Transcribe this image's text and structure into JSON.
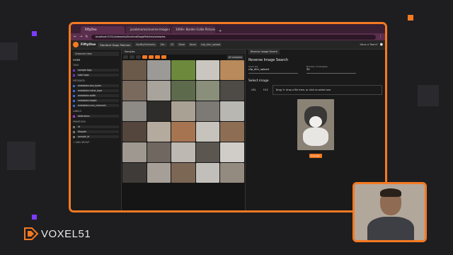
{
  "browser": {
    "tabs": [
      {
        "label": "FiftyOne"
      },
      {
        "label": "jacobmarks/reverse-image-se..."
      },
      {
        "label": "1000+ Border Collie Pictures..."
      }
    ],
    "url": "localhost:5151/datasets/StanfordDogsPatches/samples"
  },
  "app": {
    "brand": "FiftyOne",
    "dataset": "Stanford Dogs Patches",
    "view_stages": [
      "SortBySimilarity",
      "4fe..",
      "25",
      "False",
      "None",
      "clip_dim_upload"
    ],
    "header_right": "Have a Team?"
  },
  "sidebar": {
    "view_select": "Unsaved view",
    "filter_label": "FILTER",
    "sections": [
      {
        "title": "TAGS",
        "items": [
          "sample tags",
          "label tags"
        ]
      },
      {
        "title": "METADATA",
        "items": [
          "metadata.size_bytes",
          "metadata.mime_type",
          "metadata.width",
          "metadata.height",
          "metadata.num_channels"
        ]
      },
      {
        "title": "LABELS",
        "items": [
          "detections"
        ]
      },
      {
        "title": "PRIMITIVES",
        "items": [
          "id",
          "filepath",
          "sample_id"
        ]
      }
    ],
    "add_group": "+ ADD GROUP"
  },
  "grid": {
    "tab_label": "Samples",
    "count_label": "All samples"
  },
  "panel": {
    "tab_label": "Reverse Image Search",
    "title": "Reverse Image Search",
    "brain_key_label": "brain key",
    "brain_key_value": "clip_dim_upload",
    "num_samples_label": "Number of Samples",
    "num_samples_value": "50",
    "select_image_label": "Select image",
    "source_buttons": [
      "URL",
      "FILE"
    ],
    "dropzone_text": "Drag 'n' drop a file here, or click to select one",
    "execute_button": "Execute"
  },
  "branding": {
    "logo_text": "VOXEL51"
  },
  "colors": {
    "accent": "#f47a22",
    "background": "#1e1e21",
    "purple_dot": "#7b3cff"
  }
}
